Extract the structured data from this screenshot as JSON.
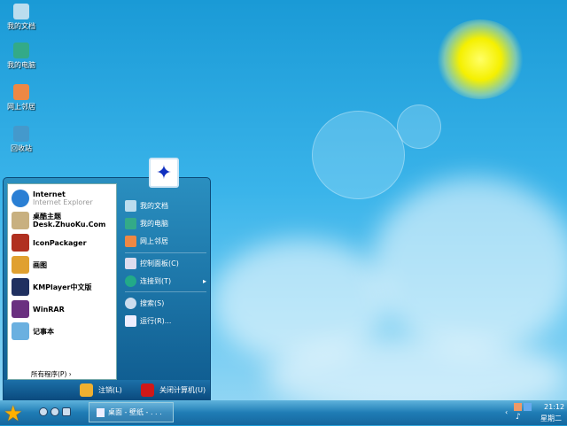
{
  "desktop": {
    "icons": [
      {
        "label": "我的文档"
      },
      {
        "label": "我的电脑"
      },
      {
        "label": "网上邻居"
      },
      {
        "label": "回收站"
      }
    ]
  },
  "start_menu": {
    "left_items": [
      {
        "label": "Internet",
        "sub": "Internet Explorer",
        "color": "#2a7fd4"
      },
      {
        "label": "桌酷主题",
        "sub": "Desk.ZhuoKu.Com",
        "color": "#c8b080"
      },
      {
        "label": "IconPackager",
        "color": "#b03020"
      },
      {
        "label": "画图",
        "color": "#e0a030"
      },
      {
        "label": "KMPlayer中文版",
        "color": "#203060"
      },
      {
        "label": "WinRAR",
        "color": "#6a3080"
      },
      {
        "label": "记事本",
        "color": "#6ab0e0"
      }
    ],
    "all_programs": "所有程序(P)",
    "right_items": [
      {
        "label": "我的文档"
      },
      {
        "label": "我的电脑"
      },
      {
        "label": "网上邻居"
      },
      {
        "label": "控制面板(C)"
      },
      {
        "label": "连接到(T)"
      },
      {
        "label": "搜索(S)"
      },
      {
        "label": "运行(R)..."
      }
    ],
    "logoff": "注销(L)",
    "shutdown": "关闭计算机(U)"
  },
  "taskbar": {
    "task": "桌面 - 壁纸 - . . .",
    "time": "21:12",
    "day": "星期二"
  }
}
